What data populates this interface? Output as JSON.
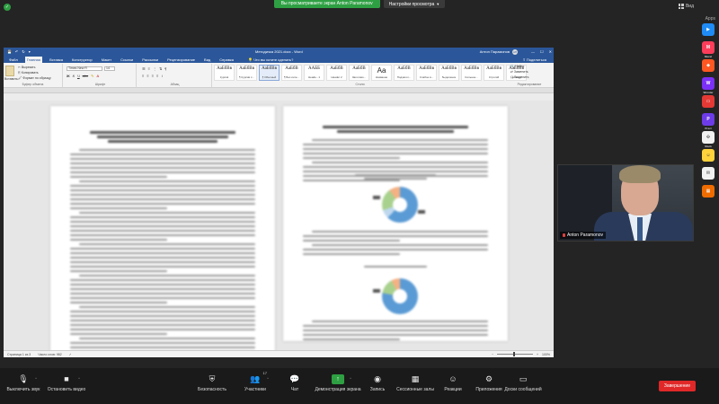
{
  "banner": {
    "share_status": "Вы просматриваете экран Anton Paramonov",
    "view_options": "Настройки просмотра",
    "view_label": "Вид"
  },
  "top": {
    "apps_label": "Аpps"
  },
  "app_rail": [
    {
      "name": "app-blue-arrow",
      "icon": "play-icon",
      "label": "",
      "color": "#1f8bf5",
      "glyph": "▶"
    },
    {
      "name": "app-mural",
      "icon": "mural-icon",
      "label": "Mural",
      "color": "#ff3d5a",
      "glyph": "M"
    },
    {
      "name": "app-orange",
      "icon": "tag-icon",
      "label": "",
      "color": "#ff5722",
      "glyph": "◆"
    },
    {
      "name": "app-wonder",
      "icon": "w-icon",
      "label": "Wonder",
      "color": "#7b2ff7",
      "glyph": "W"
    },
    {
      "name": "app-red-rect",
      "icon": "slides-icon",
      "label": "",
      "color": "#e53935",
      "glyph": "▭"
    },
    {
      "name": "app-prezi",
      "icon": "prezi-icon",
      "label": "Prezi",
      "color": "#6d3ce8",
      "glyph": "P"
    },
    {
      "name": "app-slack",
      "icon": "slack-icon",
      "label": "Slack",
      "color": "#f1f1f1",
      "glyph": "✣"
    },
    {
      "name": "app-yellow",
      "icon": "smile-icon",
      "label": "",
      "color": "#ffd23c",
      "glyph": "☺"
    },
    {
      "name": "app-gmail",
      "icon": "mail-icon",
      "label": "",
      "color": "#f1f1f1",
      "glyph": "✉"
    },
    {
      "name": "app-office",
      "icon": "grid-icon",
      "label": "",
      "color": "#ef6c00",
      "glyph": "▦"
    }
  ],
  "word": {
    "doc_title": "Методичка 2021.docx  -  Word",
    "user_name": "Антон Парамонов",
    "avatar": "АП",
    "tell_me": "Что вы хотите сделать?",
    "share": "Поделиться",
    "tabs": [
      "Файл",
      "Главная",
      "Вставка",
      "Конструктор",
      "Макет",
      "Ссылки",
      "Рассылки",
      "Рецензирование",
      "Вид",
      "Справка"
    ],
    "active_tab": 1,
    "clipboard": {
      "paste": "Вставить",
      "cut": "Вырезать",
      "copy": "Копировать",
      "format_painter": "Формат по образцу",
      "group": "Буфер обмена"
    },
    "font": {
      "family": "Times New R",
      "size": "14",
      "group": "Шрифт"
    },
    "paragraph_group": "Абзац",
    "styles": [
      {
        "preview": "АаБбВв",
        "name": "Курсив",
        "big": false,
        "blue": false
      },
      {
        "preview": "АаБбВв",
        "name": "¶ Курсив с...",
        "big": false,
        "blue": false
      },
      {
        "preview": "АаБбВв",
        "name": "¶ Обычный",
        "big": false,
        "blue": false
      },
      {
        "preview": "АаБбВ",
        "name": "¶ Без инте...",
        "big": false,
        "blue": false
      },
      {
        "preview": "ААББ",
        "name": "Heade...1",
        "big": false,
        "blue": false
      },
      {
        "preview": "АаБбВ",
        "name": "Header 2",
        "big": false,
        "blue": false
      },
      {
        "preview": "АаБбВ",
        "name": "Заголово...",
        "big": false,
        "blue": false
      },
      {
        "preview": "Аа",
        "name": "Название",
        "big": true,
        "blue": false
      },
      {
        "preview": "АаБбВ",
        "name": "Подзагол...",
        "big": false,
        "blue": false
      },
      {
        "preview": "АаБбВв",
        "name": "Слабое в...",
        "big": false,
        "blue": false
      },
      {
        "preview": "АаБбВв",
        "name": "Выделение",
        "big": false,
        "blue": false
      },
      {
        "preview": "АаБбВв",
        "name": "Сильное...",
        "big": false,
        "blue": false
      },
      {
        "preview": "АаБбВв",
        "name": "Строгий",
        "big": false,
        "blue": false
      },
      {
        "preview": "АаБбВв",
        "name": "Цитата 2",
        "big": false,
        "blue": false
      }
    ],
    "styles_group": "Стили",
    "editing": {
      "find": "Найти",
      "replace": "Заменить",
      "select": "Выделить",
      "group": "Редактирование"
    },
    "status": {
      "page": "Страница 1 из 3",
      "words": "Число слов: 982",
      "zoom": "100%"
    }
  },
  "video": {
    "name": "Anton Paramonov"
  },
  "toolbar": {
    "items": [
      {
        "name": "mute-button",
        "icon": "microphone-icon",
        "glyph": "🎙",
        "label": "Выключить звук",
        "count": "",
        "caret": true
      },
      {
        "name": "stop-video-button",
        "icon": "video-camera-icon",
        "glyph": "■",
        "label": "Остановить видео",
        "count": "",
        "caret": true
      },
      {
        "name": "security-button",
        "icon": "shield-icon",
        "glyph": "⛨",
        "label": "Безопасность",
        "count": "",
        "caret": false
      },
      {
        "name": "participants-button",
        "icon": "people-icon",
        "glyph": "👥",
        "label": "Участники",
        "count": "17",
        "caret": true
      },
      {
        "name": "chat-button",
        "icon": "chat-bubble-icon",
        "glyph": "💬",
        "label": "Чат",
        "count": "",
        "caret": false
      },
      {
        "name": "share-screen-button",
        "icon": "share-arrow-icon",
        "glyph": "↑",
        "label": "Демонстрация экрана",
        "count": "",
        "caret": true
      },
      {
        "name": "record-button",
        "icon": "record-icon",
        "glyph": "◉",
        "label": "Запись",
        "count": "",
        "caret": false
      },
      {
        "name": "breakout-rooms-button",
        "icon": "rooms-icon",
        "glyph": "▦",
        "label": "Сессионные залы",
        "count": "",
        "caret": false
      },
      {
        "name": "reactions-button",
        "icon": "smiley-icon",
        "glyph": "☺",
        "label": "Реакции",
        "count": "",
        "caret": false
      },
      {
        "name": "apps-button",
        "icon": "apps-icon",
        "glyph": "⚙",
        "label": "Приложения",
        "count": "",
        "caret": false
      },
      {
        "name": "whiteboard-button",
        "icon": "whiteboard-icon",
        "glyph": "▭",
        "label": "Доски сообщений",
        "count": "",
        "caret": false
      }
    ],
    "end": "Завершение"
  }
}
